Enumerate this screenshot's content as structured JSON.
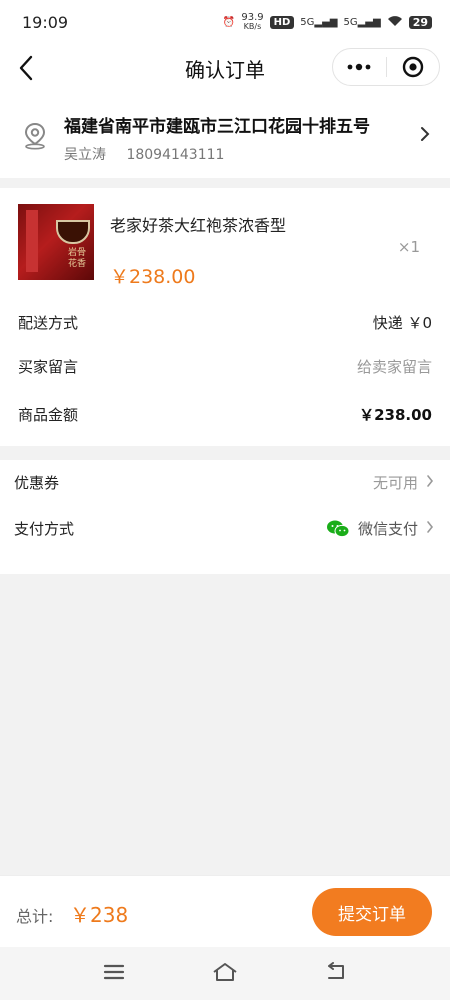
{
  "status_bar": {
    "time": "19:09",
    "speed": "93.9",
    "speed_unit": "KB/s",
    "hd": "HD",
    "net1": "5G",
    "net2": "5G",
    "battery": "29"
  },
  "nav": {
    "title": "确认订单",
    "icons": [
      "back-icon",
      "more-icon",
      "close-mini-program-icon"
    ]
  },
  "address": {
    "line": "福建省南平市建瓯市三江口花园十排五号",
    "name": "吴立涛",
    "phone": "18094143111",
    "icon": "location-icon"
  },
  "product": {
    "name": "老家好茶大红袍茶浓香型",
    "price": "￥238.00",
    "quantity": "×1",
    "image_text": "岩骨花香"
  },
  "order_rows": {
    "delivery_label": "配送方式",
    "delivery_value": "快递 ￥0",
    "message_label": "买家留言",
    "message_placeholder": "给卖家留言",
    "amount_label": "商品金额",
    "amount_value": "￥238.00"
  },
  "payment": {
    "coupon_label": "优惠券",
    "coupon_value": "无可用",
    "method_label": "支付方式",
    "method_value": "微信支付",
    "method_icon": "wechat-icon"
  },
  "footer": {
    "total_label": "总计:",
    "total_value": "￥238",
    "submit_label": "提交订单"
  },
  "colors": {
    "accent": "#f27c20",
    "price": "#ee7a1c",
    "wechat": "#1aad19"
  }
}
